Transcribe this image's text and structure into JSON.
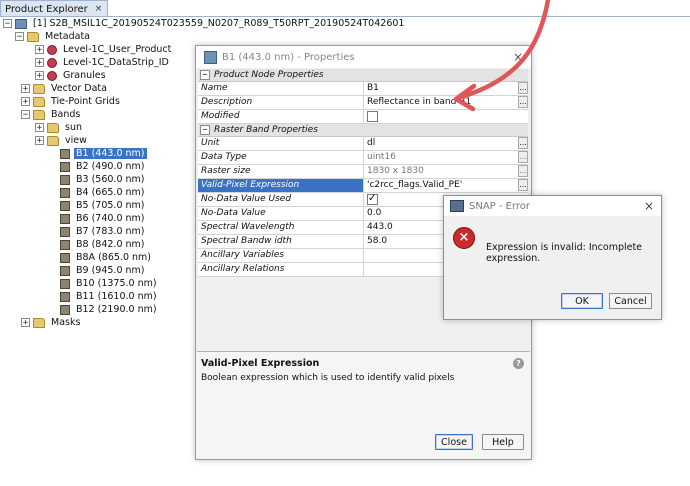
{
  "explorer": {
    "tab_label": "Product Explorer",
    "close_glyph": "×",
    "product": "[1] S2B_MSIL1C_20190524T023559_N0207_R089_T50RPT_20190524T042601",
    "metadata": {
      "label": "Metadata",
      "items": [
        "Level-1C_User_Product",
        "Level-1C_DataStrip_ID",
        "Granules"
      ]
    },
    "vector_data": "Vector Data",
    "tie_point_grids": "Tie-Point Grids",
    "bands": {
      "label": "Bands",
      "folders": [
        "sun",
        "view"
      ],
      "items": [
        "B1 (443.0 nm)",
        "B2 (490.0 nm)",
        "B3 (560.0 nm)",
        "B4 (665.0 nm)",
        "B5 (705.0 nm)",
        "B6 (740.0 nm)",
        "B7 (783.0 nm)",
        "B8 (842.0 nm)",
        "B8A (865.0 nm)",
        "B9 (945.0 nm)",
        "B10 (1375.0 nm)",
        "B11 (1610.0 nm)",
        "B12 (2190.0 nm)"
      ],
      "selected": "B1 (443.0 nm)"
    },
    "masks": "Masks"
  },
  "properties": {
    "title": "B1 (443.0 nm) - Properties",
    "section1": "Product Node Properties",
    "section2": "Raster Band Properties",
    "rows1": [
      {
        "key": "Name",
        "value": "B1"
      },
      {
        "key": "Description",
        "value": "Reflectance in band B1"
      },
      {
        "key": "Modified",
        "value": ""
      }
    ],
    "rows2": [
      {
        "key": "Unit",
        "value": "dl"
      },
      {
        "key": "Data Type",
        "value": "uint16"
      },
      {
        "key": "Raster size",
        "value": "1830 x 1830"
      },
      {
        "key": "Valid-Pixel Expression",
        "value": "'c2rcc_flags.Valid_PE'"
      },
      {
        "key": "No-Data Value Used",
        "value": ""
      },
      {
        "key": "No-Data Value",
        "value": "0.0"
      },
      {
        "key": "Spectral Wavelength",
        "value": "443.0"
      },
      {
        "key": "Spectral Bandw idth",
        "value": "58.0"
      },
      {
        "key": "Ancillary Variables",
        "value": ""
      },
      {
        "key": "Ancillary Relations",
        "value": ""
      }
    ],
    "desc_title": "Valid-Pixel Expression",
    "desc_text": "Boolean expression which is used to identify valid pixels",
    "close_button": "Close",
    "help_button": "Help",
    "dots": "...",
    "close_glyph": "×",
    "help_glyph": "?"
  },
  "error_dialog": {
    "title": "SNAP - Error",
    "message": "Expression is invalid: Incomplete expression.",
    "ok_button": "OK",
    "cancel_button": "Cancel",
    "close_glyph": "×",
    "error_glyph": "×"
  },
  "colors": {
    "selection": "#3a73c6",
    "annotation_arrow": "#e0575a"
  }
}
